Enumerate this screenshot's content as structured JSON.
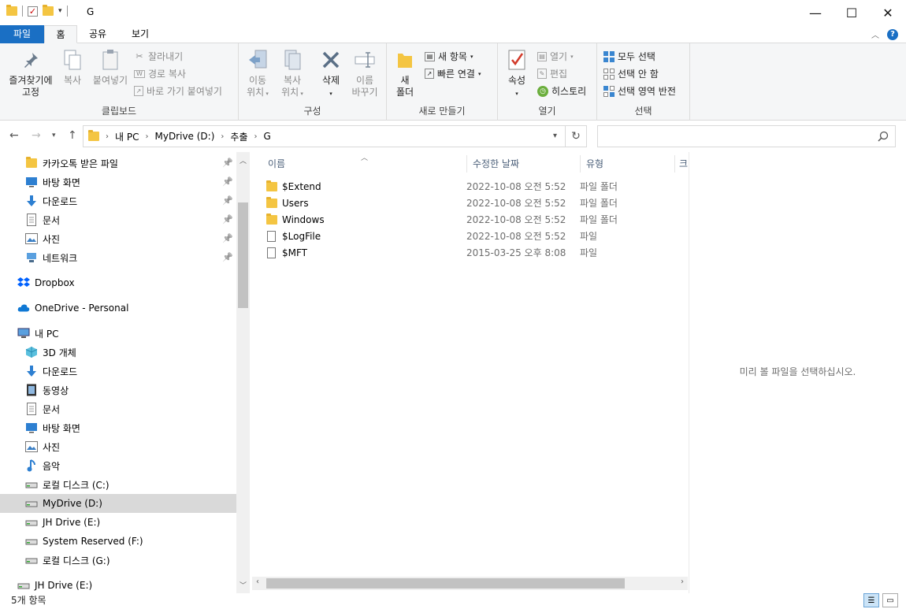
{
  "window": {
    "title": "G",
    "minimize": "—",
    "maximize": "☐",
    "close": "✕"
  },
  "tabs": {
    "file": "파일",
    "home": "홈",
    "share": "공유",
    "view": "보기"
  },
  "ribbon": {
    "clipboard": {
      "label": "클립보드",
      "pin": "즐겨찾기에\n고정",
      "copy": "복사",
      "paste": "붙여넣기",
      "cut": "잘라내기",
      "copy_path": "경로 복사",
      "paste_shortcut": "바로 가기 붙여넣기"
    },
    "organize": {
      "label": "구성",
      "move": "이동\n위치",
      "copy_to": "복사\n위치",
      "delete": "삭제",
      "rename": "이름\n바꾸기"
    },
    "new": {
      "label": "새로 만들기",
      "new_folder": "새\n폴더",
      "new_item": "새 항목",
      "easy_access": "빠른 연결"
    },
    "open": {
      "label": "열기",
      "properties": "속성",
      "open": "열기",
      "edit": "편집",
      "history": "히스토리"
    },
    "select": {
      "label": "선택",
      "select_all": "모두 선택",
      "select_none": "선택 안 함",
      "invert": "선택 영역 반전"
    }
  },
  "address": {
    "crumbs": [
      "내 PC",
      "MyDrive (D:)",
      "추출",
      "G"
    ],
    "search_placeholder": ""
  },
  "nav": {
    "items": [
      {
        "label": "카카오톡 받은 파일",
        "icon": "folder-icon",
        "pinned": true
      },
      {
        "label": "바탕 화면",
        "icon": "desktop-icon",
        "pinned": true
      },
      {
        "label": "다운로드",
        "icon": "download-icon",
        "pinned": true
      },
      {
        "label": "문서",
        "icon": "document-icon",
        "pinned": true
      },
      {
        "label": "사진",
        "icon": "picture-icon",
        "pinned": true
      },
      {
        "label": "네트워크",
        "icon": "network-icon",
        "pinned": true
      },
      {
        "label": "Dropbox",
        "icon": "dropbox-icon",
        "pinned": false
      },
      {
        "label": "OneDrive - Personal",
        "icon": "cloud-icon",
        "pinned": false
      },
      {
        "label": "내 PC",
        "icon": "pc-icon",
        "pinned": false
      },
      {
        "label": "3D 개체",
        "icon": "cube-icon",
        "pinned": false
      },
      {
        "label": "다운로드",
        "icon": "download-icon",
        "pinned": false
      },
      {
        "label": "동영상",
        "icon": "video-icon",
        "pinned": false
      },
      {
        "label": "문서",
        "icon": "document-icon",
        "pinned": false
      },
      {
        "label": "바탕 화면",
        "icon": "desktop-icon",
        "pinned": false
      },
      {
        "label": "사진",
        "icon": "picture-icon",
        "pinned": false
      },
      {
        "label": "음악",
        "icon": "music-icon",
        "pinned": false
      },
      {
        "label": "로컬 디스크 (C:)",
        "icon": "drive-icon",
        "pinned": false
      },
      {
        "label": "MyDrive (D:)",
        "icon": "drive-icon",
        "pinned": false,
        "selected": true
      },
      {
        "label": "JH Drive (E:)",
        "icon": "drive-icon",
        "pinned": false
      },
      {
        "label": "System Reserved (F:)",
        "icon": "drive-icon",
        "pinned": false
      },
      {
        "label": "로컬 디스크 (G:)",
        "icon": "drive-icon",
        "pinned": false
      },
      {
        "label": "JH Drive (E:)",
        "icon": "drive-icon",
        "pinned": false
      }
    ]
  },
  "files": {
    "columns": {
      "name": "이름",
      "modified": "수정한 날짜",
      "type": "유형",
      "size": "크"
    },
    "rows": [
      {
        "name": "$Extend",
        "date": "2022-10-08 오전 5:52",
        "type": "파일 폴더",
        "kind": "folder"
      },
      {
        "name": "Users",
        "date": "2022-10-08 오전 5:52",
        "type": "파일 폴더",
        "kind": "folder"
      },
      {
        "name": "Windows",
        "date": "2022-10-08 오전 5:52",
        "type": "파일 폴더",
        "kind": "folder"
      },
      {
        "name": "$LogFile",
        "date": "2022-10-08 오전 5:52",
        "type": "파일",
        "kind": "file"
      },
      {
        "name": "$MFT",
        "date": "2015-03-25 오후 8:08",
        "type": "파일",
        "kind": "file"
      }
    ]
  },
  "preview": {
    "message": "미리 볼 파일을 선택하십시오."
  },
  "status": {
    "count": "5개 항목"
  },
  "colors": {
    "accent": "#1a6fc4",
    "folder": "#f4c542",
    "selected": "#d9d9d9"
  }
}
